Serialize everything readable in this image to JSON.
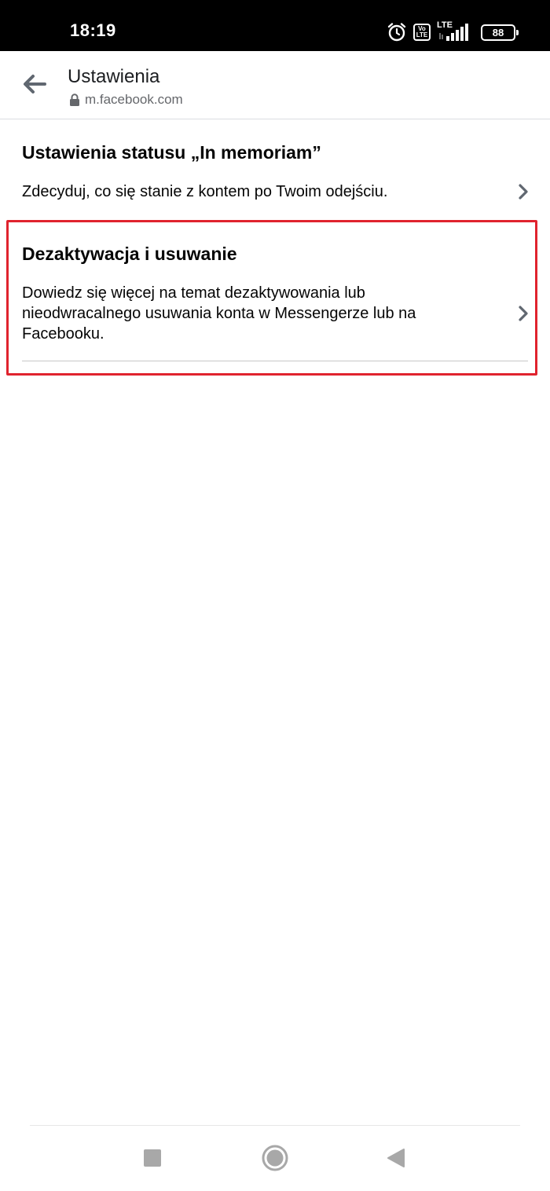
{
  "status_bar": {
    "time": "18:19",
    "icons": [
      "alarm-icon",
      "volte-icon",
      "lte-signal-icon",
      "battery-icon"
    ],
    "volte_label_top": "Vo",
    "volte_label_bottom": "LTE",
    "network_label": "LTE",
    "battery_level": "88"
  },
  "header": {
    "title": "Ustawienia",
    "url": "m.facebook.com",
    "back_icon": "arrow-left-icon",
    "lock_icon": "lock-icon"
  },
  "settings": {
    "items": [
      {
        "title": "Ustawienia statusu „In memoriam”",
        "description": "Zdecyduj, co się stanie z kontem po Twoim odejściu."
      },
      {
        "title": "Dezaktywacja i usuwanie",
        "description": "Dowiedz się więcej na temat dezaktywowania lub nieodwracalnego usuwania konta w Messengerze lub na Facebooku."
      }
    ]
  },
  "colors": {
    "highlight": "#e0232e",
    "chevron": "#606770",
    "status_bar_bg": "#000000"
  },
  "navigation": {
    "icons": [
      "recent-apps-icon",
      "home-icon",
      "back-icon"
    ]
  }
}
